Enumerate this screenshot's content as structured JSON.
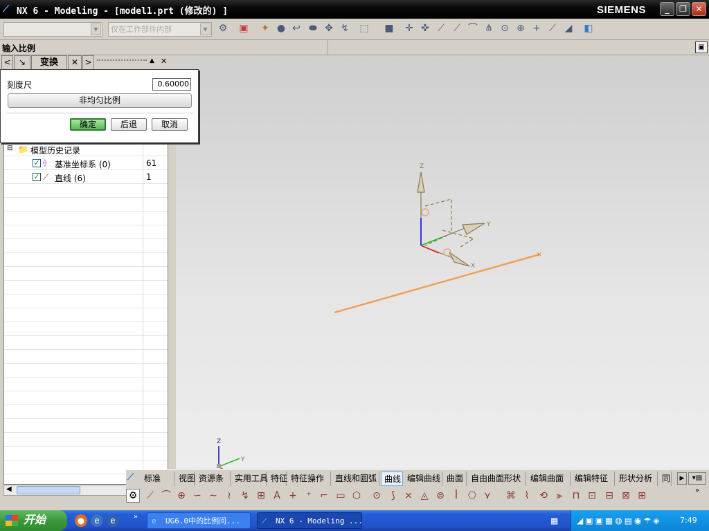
{
  "titlebar": {
    "title": "NX 6 - Modeling - [model1.prt (修改的) ]",
    "brand": "SIEMENS",
    "minimize": "_",
    "restore": "❐",
    "close": "✕"
  },
  "toolbar": {
    "combo1_value": "",
    "combo2_value": "仅在工作部件内部"
  },
  "cue": {
    "text": "输入比例"
  },
  "dialog": {
    "title": "变换",
    "scale_label": "刻度尺",
    "scale_value": "0.60000",
    "nonuniform_label": "非均匀比例",
    "ok_label": "确定",
    "back_label": "后退",
    "cancel_label": "取消"
  },
  "navigator": {
    "root_label": "模型历史记录",
    "items": [
      {
        "label": "基准坐标系 (0)",
        "value": "61"
      },
      {
        "label": "直线 (6)",
        "value": "1"
      }
    ]
  },
  "viewport": {
    "axis_z": "Z",
    "axis_y": "Y",
    "axis_x": "X",
    "mini_z": "Z",
    "mini_y": "Y"
  },
  "bottom_tabs": [
    "标准",
    "视图",
    "资源条",
    "实用工具",
    "特征",
    "特征操作",
    "直线和圆弧",
    "曲线",
    "编辑曲线",
    "曲面",
    "自由曲面形状",
    "编辑曲面",
    "编辑特征",
    "形状分析",
    "同"
  ],
  "active_tab": "曲线",
  "taskbar": {
    "start_label": "开始",
    "task1": "UG6.0中的比例问...",
    "task2": "NX 6 - Modeling ...",
    "clock": "7:49"
  },
  "colors": {
    "line_orange": "#f0a050",
    "axis_olive": "#8a7a50",
    "taskbar_blue": "#245ed8",
    "start_green": "#3b9a3b"
  }
}
